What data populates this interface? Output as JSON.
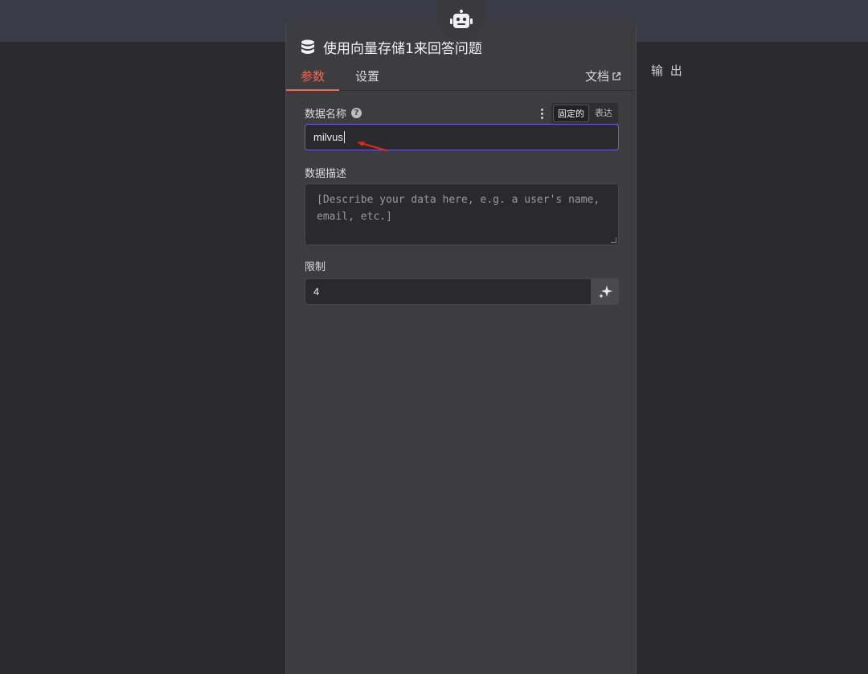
{
  "background": {
    "top_band_color": "#3b3a47",
    "canvas_color": "#2a2a2c"
  },
  "output_label": "输 出",
  "node": {
    "title": "使用向量存储1来回答问题",
    "robot_icon": "robot-icon",
    "db_icon": "database-icon"
  },
  "tabs": [
    {
      "label": "参数",
      "active": true
    },
    {
      "label": "设置",
      "active": false
    }
  ],
  "docs_label": "文档",
  "fields": {
    "data_name": {
      "label": "数据名称",
      "help_icon": "?",
      "value": "milvus",
      "mode_options": [
        "固定的",
        "表达"
      ],
      "selected_mode": "固定的"
    },
    "data_description": {
      "label": "数据描述",
      "placeholder": "[Describe your data here, e.g. a user's name, email, etc.]"
    },
    "limit": {
      "label": "限制",
      "value": "4"
    }
  },
  "colors": {
    "accent": "#f06a5c",
    "focus": "#6b5fd8",
    "annotation_arrow": "#e0261e"
  }
}
